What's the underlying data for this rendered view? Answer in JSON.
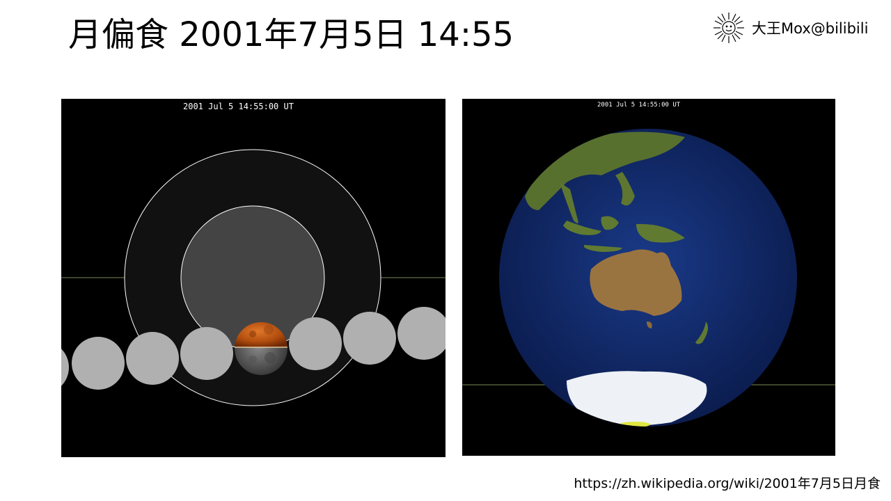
{
  "slide": {
    "title": "月偏食 2001年7月5日 14:55",
    "author": "大王Mox@bilibili",
    "logo_icon": "sun-face-icon",
    "source_url": "https://zh.wikipedia.org/wiki/2001年7月5日月食"
  },
  "left_panel": {
    "timestamp": "2001 Jul  5 14:55:00 UT"
  },
  "right_panel": {
    "timestamp": "2001 Jul  5 14:55:00 UT"
  },
  "colors": {
    "background": "#000000",
    "penumbra": "#111111",
    "umbra": "#444444",
    "moon_track": "#b0b0b0",
    "eclipsed_moon": "#c05810",
    "ocean": "#0d2460",
    "land": "#6b7a3a",
    "ice": "#eef2f6",
    "ecliptic_line": "#7a8a55"
  }
}
